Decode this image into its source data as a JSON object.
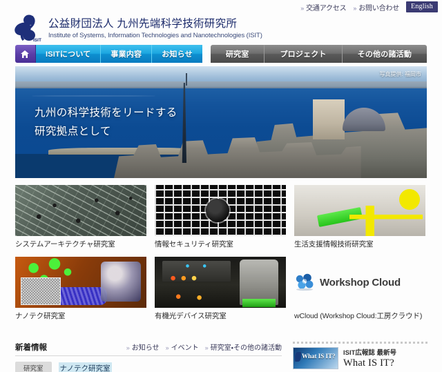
{
  "utility": {
    "links": [
      {
        "label": "交通アクセス",
        "name": "access-link"
      },
      {
        "label": "お問い合わせ",
        "name": "contact-link"
      }
    ],
    "english_button": "English"
  },
  "header": {
    "title_ja": "公益財団法人 九州先端科学技術研究所",
    "title_en": "Institute of Systems, Information Technologies and Nanotechnologies (ISIT)",
    "logo_text": "ISIT"
  },
  "nav": {
    "home_icon": "house-icon",
    "primary": [
      {
        "label": "ISITについて",
        "name": "nav-about"
      },
      {
        "label": "事業内容",
        "name": "nav-business"
      },
      {
        "label": "お知らせ",
        "name": "nav-news"
      }
    ],
    "secondary": [
      {
        "label": "研究室",
        "name": "nav-labs"
      },
      {
        "label": "プロジェクト",
        "name": "nav-projects"
      },
      {
        "label": "その他の諸活動",
        "name": "nav-other-activities"
      }
    ]
  },
  "hero": {
    "line1": "九州の科学技術をリードする",
    "line2": "研究拠点として",
    "credit": "写真提供: 福岡市"
  },
  "cards": {
    "row1": [
      {
        "label": "システムアーキテクチャ研究室",
        "art": "th-pcb",
        "name": "card-system-architecture"
      },
      {
        "label": "情報セキュリティ研究室",
        "art": "th-sec",
        "name": "card-information-security"
      },
      {
        "label": "生活支援情報技術研究室",
        "art": "th-life",
        "name": "card-life-support-it"
      }
    ],
    "row2": [
      {
        "label": "ナノテク研究室",
        "art": "th-nano",
        "name": "card-nanotech"
      },
      {
        "label": "有機光デバイス研究室",
        "art": "th-opt",
        "name": "card-organic-photonic-device"
      }
    ],
    "wcloud": {
      "logo_text": "Workshop Cloud",
      "label": "wCloud (Workshop Cloud:工房クラウド)",
      "name": "card-wcloud"
    }
  },
  "news": {
    "title": "新着情報",
    "links": [
      {
        "label": "お知らせ",
        "name": "news-link-notices"
      },
      {
        "label": "イベント",
        "name": "news-link-events"
      },
      {
        "label": "研究室・その他の諸活動",
        "name": "news-link-labs-activities"
      }
    ],
    "rows": [
      {
        "category": "研究室",
        "text": "ナノテク研究室"
      }
    ]
  },
  "widget": {
    "kicker": "ISIT広報誌 最新号",
    "headline": "What IS IT?",
    "thumb_label": "What IS IT?"
  },
  "colors": {
    "brand_navy": "#1b2a6b",
    "nav_blue": "#1ba6e0",
    "nav_purple": "#5c3fa8",
    "nav_gray": "#6e6e6e",
    "english_btn": "#3b3b73",
    "highlight": "#cfe8f2",
    "page_bg": "#fdfdfd"
  }
}
